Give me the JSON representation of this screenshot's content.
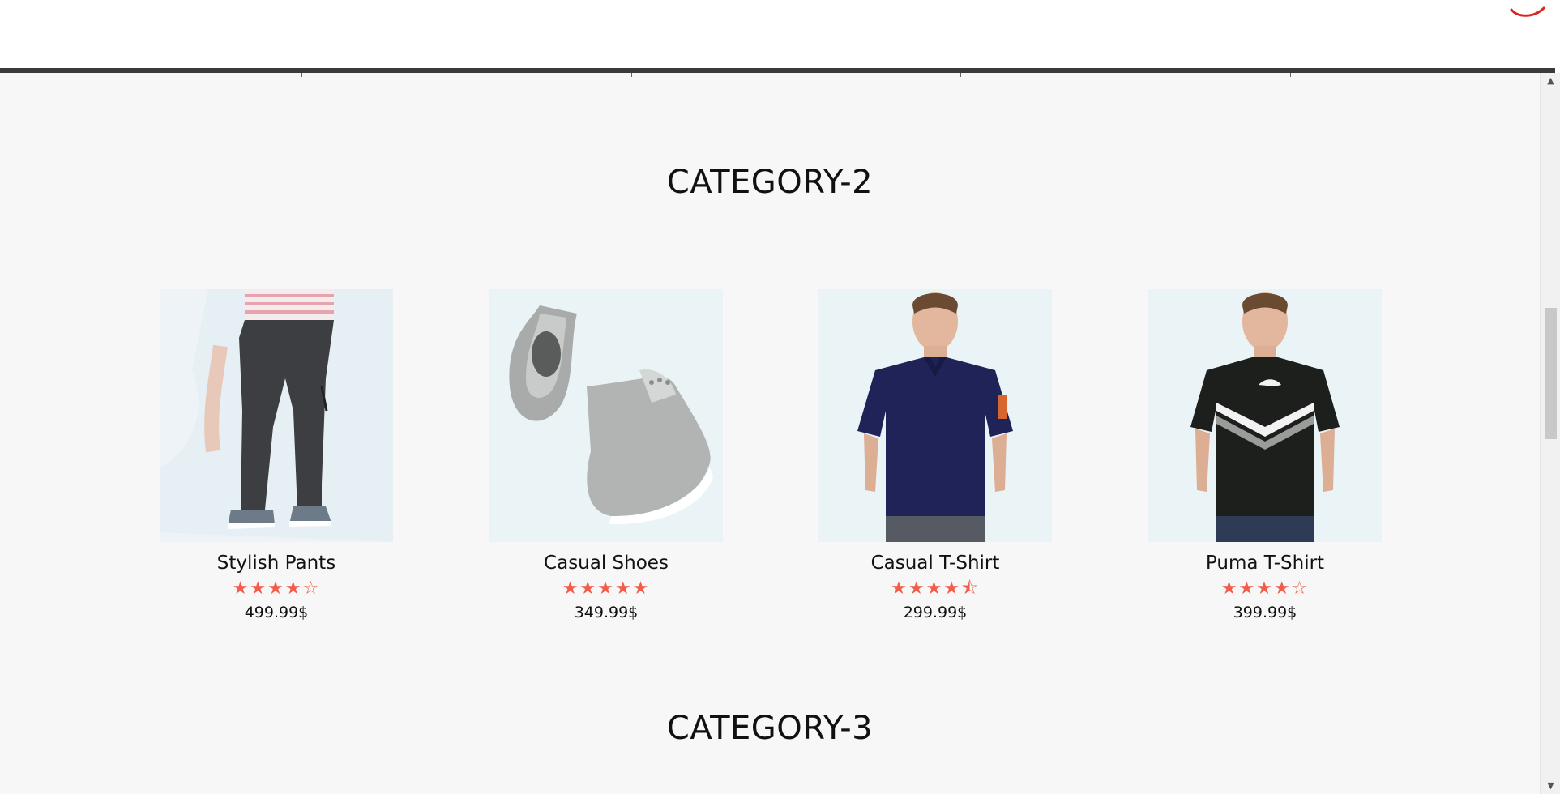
{
  "sections": [
    {
      "title": "CATEGORY-2",
      "products": [
        {
          "name": "Stylish Pants",
          "rating": 4,
          "stars": "★★★★☆",
          "price": "499.99$",
          "image": "pants"
        },
        {
          "name": "Casual Shoes",
          "rating": 5,
          "stars": "★★★★★",
          "price": "349.99$",
          "image": "shoes"
        },
        {
          "name": "Casual T-Shirt",
          "rating": 4.5,
          "stars": "★★★★⯪",
          "price": "299.99$",
          "image": "polo-shirt"
        },
        {
          "name": "Puma T-Shirt",
          "rating": 4,
          "stars": "★★★★☆",
          "price": "399.99$",
          "image": "puma-tshirt"
        }
      ]
    },
    {
      "title": "CATEGORY-3",
      "products": []
    }
  ],
  "colors": {
    "background": "#f6f7f6",
    "star": "#f25c4a",
    "header_rule": "#3a3a3a",
    "image_bg": "#eaf2f6"
  },
  "scrollbar": {
    "position": 0.33
  }
}
